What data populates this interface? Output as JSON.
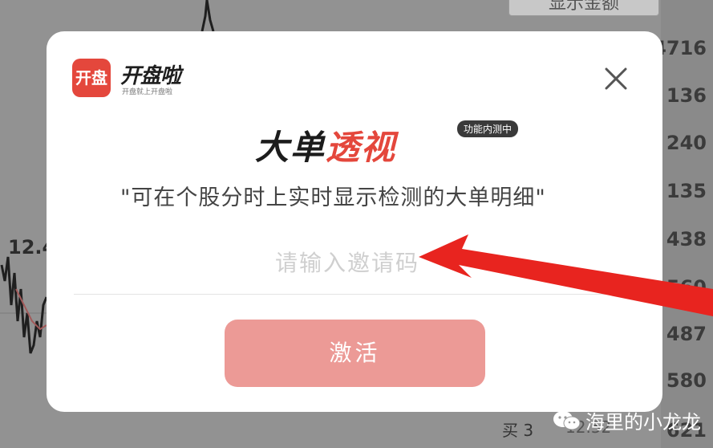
{
  "background": {
    "top_button_label": "显示金额",
    "left_price": "12.4",
    "right_values": [
      "4716",
      "136",
      "240",
      "135",
      "438",
      "560",
      "487",
      "580",
      "621"
    ],
    "bottom_label": "买 3",
    "bottom_price": "12.52"
  },
  "dialog": {
    "logo_text": "开盘",
    "app_name": "开盘啦",
    "slogan": "开盘就上开盘啦",
    "title_part1": "大单",
    "title_part2": "透视",
    "beta_tag": "功能内测中",
    "subtitle": "\"可在个股分时上实时显示检测的大单明细\"",
    "input_placeholder": "请输入邀请码",
    "activate_label": "激活"
  },
  "watermark": {
    "text": "海里的小龙龙"
  },
  "colors": {
    "accent": "#e4473c",
    "button_disabled": "#ec9a96",
    "arrow": "#e8241f"
  }
}
